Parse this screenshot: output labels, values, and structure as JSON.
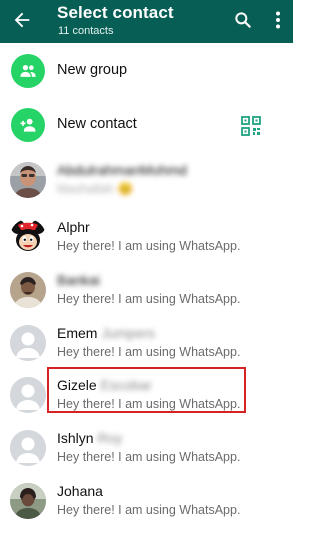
{
  "header": {
    "title": "Select contact",
    "subtitle": "11 contacts"
  },
  "actions": [
    {
      "label": "New group"
    },
    {
      "label": "New contact"
    }
  ],
  "contacts": [
    {
      "name": "AbdulrahmanMohmd",
      "status": "Mashallah 😊"
    },
    {
      "name": "Alphr",
      "status": "Hey there! I am using WhatsApp."
    },
    {
      "name": "Bankai",
      "status": "Hey there! I am using WhatsApp."
    },
    {
      "name_first": "Emem",
      "name_last": "Jumpers",
      "status": "Hey there! I am using WhatsApp."
    },
    {
      "name_first": "Gizele",
      "name_last": "Escobar",
      "status": "Hey there! I am using WhatsApp."
    },
    {
      "name_first": "Ishlyn",
      "name_last": "Roy",
      "status": "Hey there! I am using WhatsApp."
    },
    {
      "name": "Johana",
      "status": "Hey there! I am using WhatsApp."
    }
  ],
  "colors": {
    "header": "#075e54",
    "accent": "#25d366",
    "highlight": "#d62222"
  }
}
